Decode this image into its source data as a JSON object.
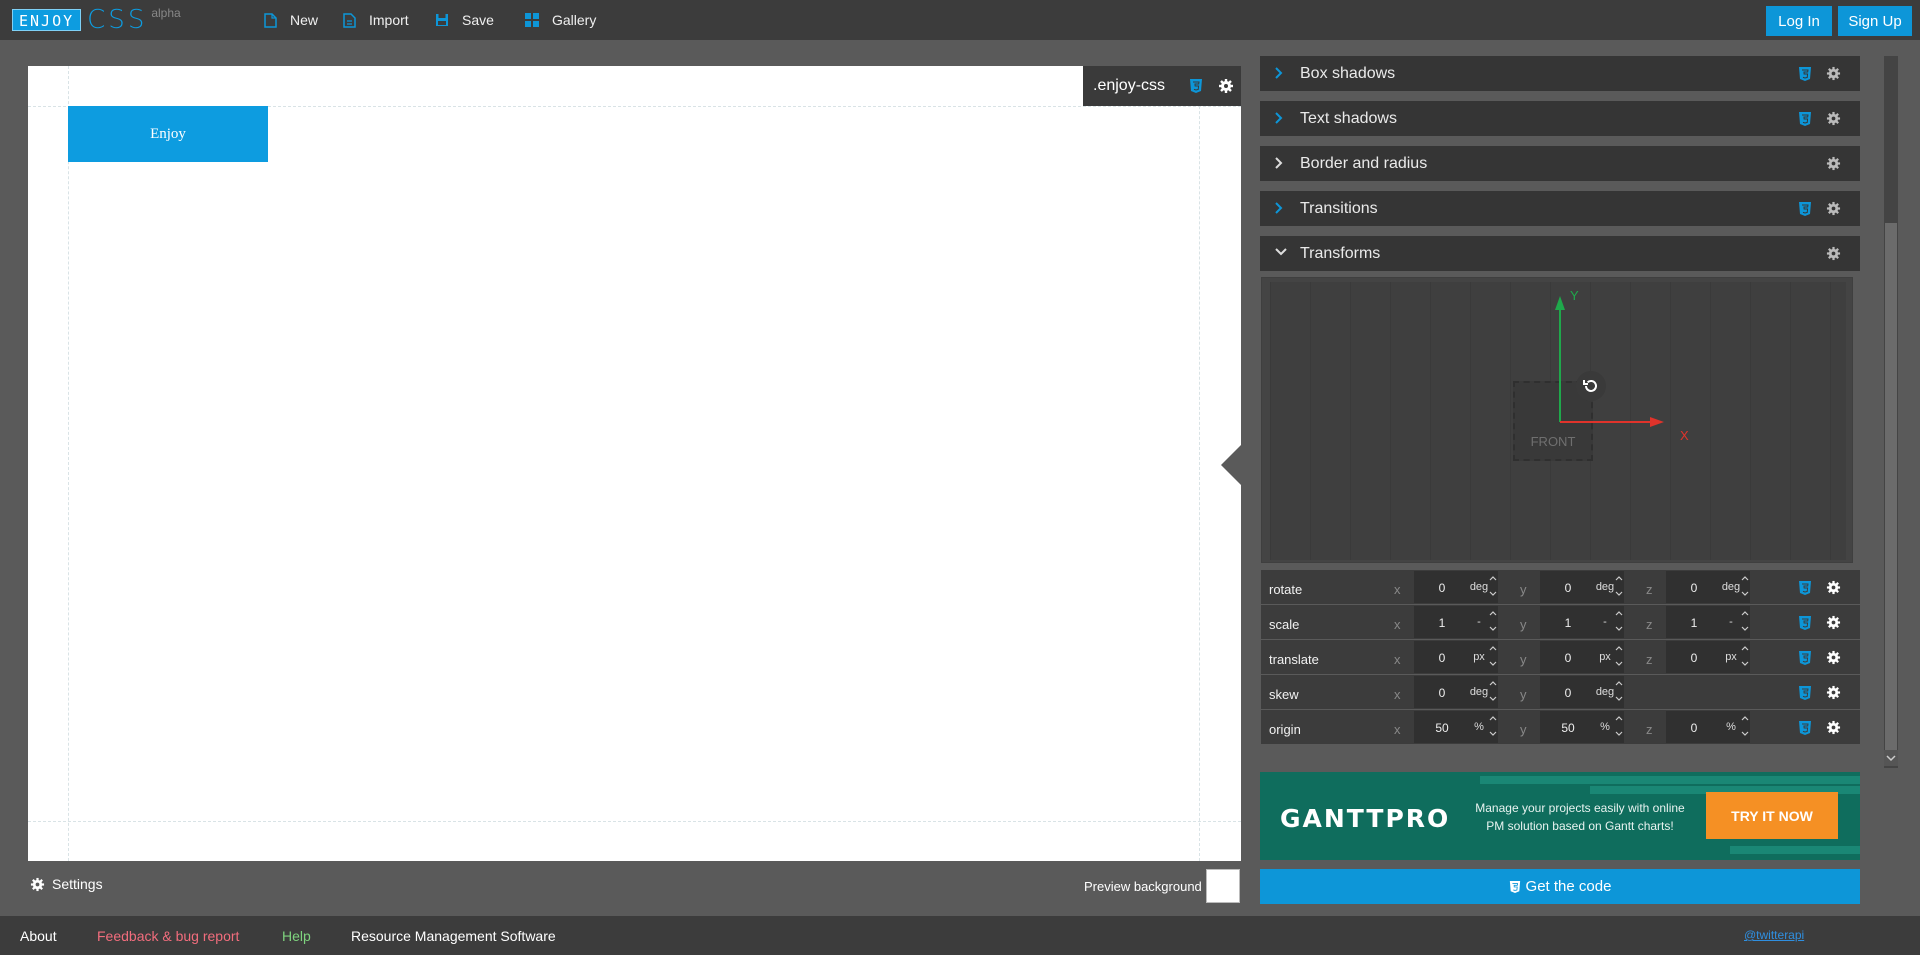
{
  "app": {
    "logo_box": "ENJOY",
    "logo_css": "CSS",
    "logo_tag": "alpha"
  },
  "nav": {
    "new_label": "New",
    "import_label": "Import",
    "save_label": "Save",
    "gallery_label": "Gallery",
    "login_label": "Log In",
    "signup_label": "Sign Up"
  },
  "preview": {
    "button_text": "Enjoy",
    "selector": ".enjoy-css",
    "settings_label": "Settings",
    "background_label": "Preview background"
  },
  "sections": [
    {
      "title": "Box shadows",
      "expanded": false
    },
    {
      "title": "Text shadows",
      "expanded": false
    },
    {
      "title": "Border and radius",
      "expanded": false
    },
    {
      "title": "Transitions",
      "expanded": false
    },
    {
      "title": "Transforms",
      "expanded": true
    }
  ],
  "stage": {
    "y_axis": "Y",
    "x_axis": "X",
    "front_label": "FRONT"
  },
  "transforms": [
    {
      "name": "rotate",
      "x": {
        "value": "0",
        "unit": "deg"
      },
      "y": {
        "value": "0",
        "unit": "deg"
      },
      "z": {
        "value": "0",
        "unit": "deg"
      }
    },
    {
      "name": "scale",
      "x": {
        "value": "1",
        "unit": "-"
      },
      "y": {
        "value": "1",
        "unit": "-"
      },
      "z": {
        "value": "1",
        "unit": "-"
      }
    },
    {
      "name": "translate",
      "x": {
        "value": "0",
        "unit": "px"
      },
      "y": {
        "value": "0",
        "unit": "px"
      },
      "z": {
        "value": "0",
        "unit": "px"
      }
    },
    {
      "name": "skew",
      "x": {
        "value": "0",
        "unit": "deg"
      },
      "y": {
        "value": "0",
        "unit": "deg"
      }
    },
    {
      "name": "origin",
      "x": {
        "value": "50",
        "unit": "%"
      },
      "y": {
        "value": "50",
        "unit": "%"
      },
      "z": {
        "value": "0",
        "unit": "%"
      }
    }
  ],
  "axis_letters": {
    "x": "x",
    "y": "y",
    "z": "z"
  },
  "ad": {
    "brand": "GANTTPRO",
    "line1": "Manage your projects easily with online",
    "line2": "PM solution based on Gantt charts!",
    "cta": "TRY IT NOW"
  },
  "get_code": "Get the code",
  "footer": {
    "about": "About",
    "feedback": "Feedback & bug report",
    "help": "Help",
    "resource": "Resource Management Software",
    "twitter": "@twitterapi"
  },
  "colors": {
    "accent": "#0d96d8",
    "feedback": "#f26d7d",
    "help": "#7ed37e",
    "ad_bg": "#0f6d5d",
    "ad_cta": "#f59024"
  }
}
